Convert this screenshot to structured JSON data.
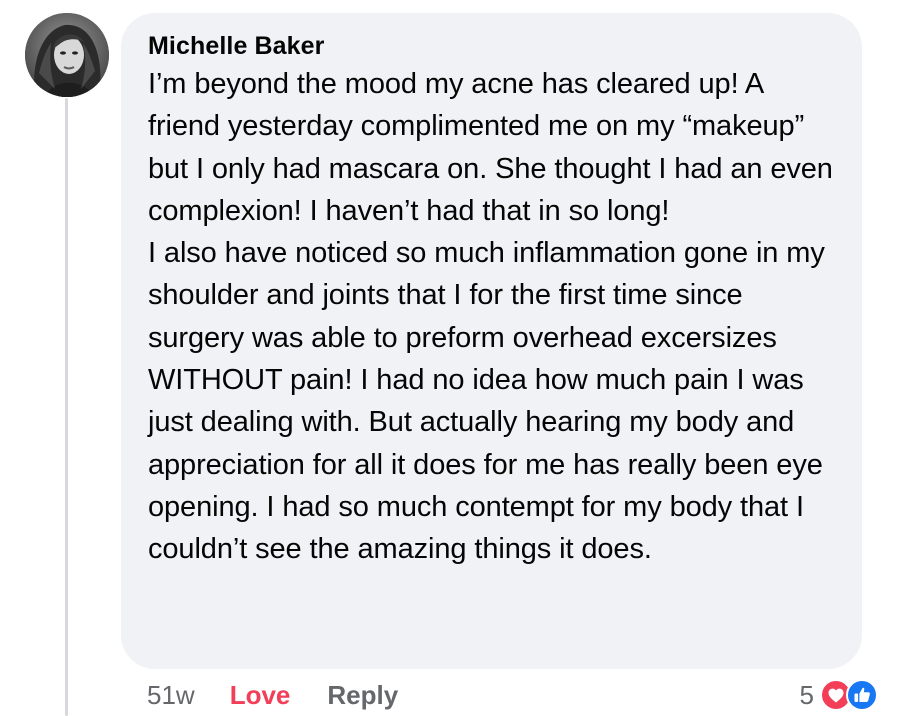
{
  "comment": {
    "author": "Michelle Baker",
    "paragraphs": [
      "I’m beyond the mood my acne has cleared up! A friend yesterday complimented me on my “makeup” but I only had mascara on. She thought I had an even complexion! I haven’t had that in so long!",
      "I also have noticed so much inflammation gone in my shoulder and joints that I for the first time since surgery was able to preform overhead excersizes WITHOUT pain! I had no idea how much pain I was just dealing with. But actually hearing my body and appreciation for all it does for me has really been eye opening. I had so much contempt for my body that I couldn’t see the amazing things it does."
    ]
  },
  "actions": {
    "timestamp": "51w",
    "love_label": "Love",
    "reply_label": "Reply"
  },
  "reactions": {
    "count": "5",
    "icons": [
      "love-reaction-icon",
      "like-reaction-icon"
    ],
    "love_color": "#f33e58",
    "like_color": "#1877f2"
  },
  "colors": {
    "bubble": "#f0f2f5",
    "secondary_text": "#65676b",
    "thread_line": "#d6d8dc"
  }
}
